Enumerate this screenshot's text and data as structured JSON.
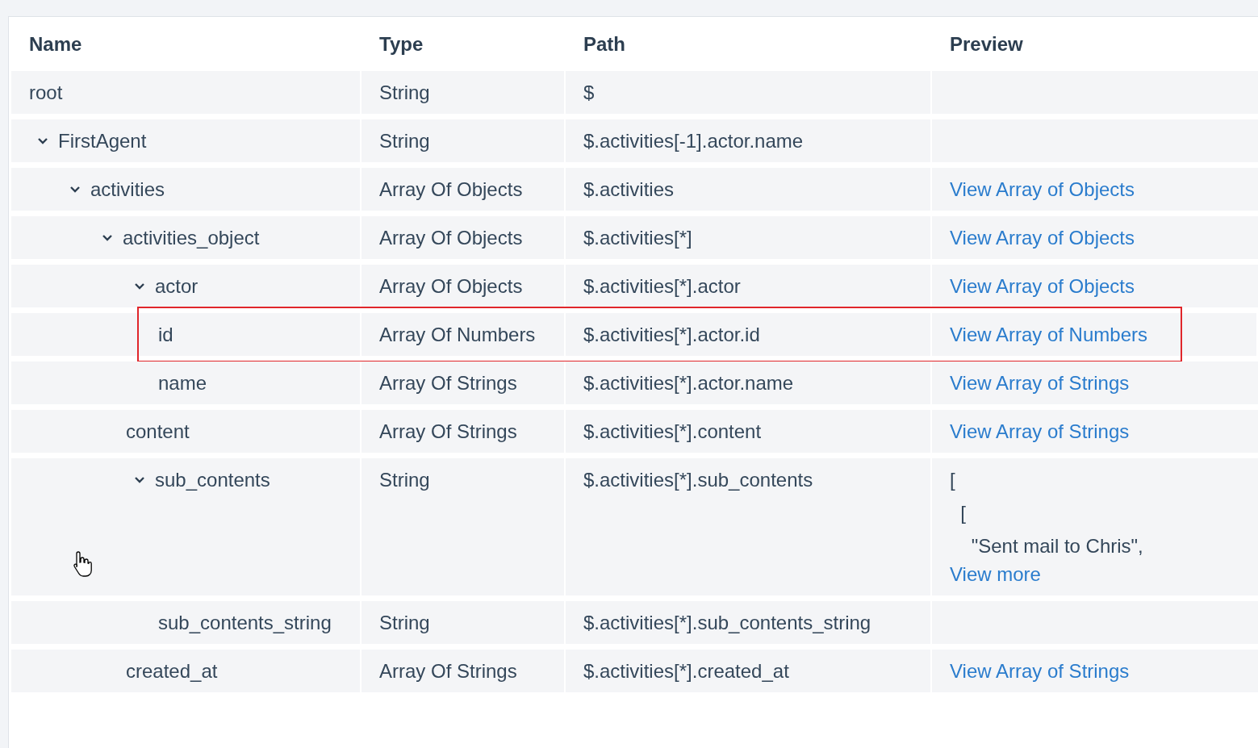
{
  "table": {
    "columns": [
      "Name",
      "Type",
      "Path",
      "Preview"
    ],
    "rows": [
      {
        "name": "root",
        "type": "String",
        "path": "$"
      },
      {
        "name": "FirstAgent",
        "type": "String",
        "path": "$.activities[-1].actor.name",
        "expanded": true,
        "children": [
          {
            "name": "activities",
            "type": "Array Of Objects",
            "path": "$.activities",
            "preview": {
              "link": "View Array of Objects"
            },
            "expanded": true,
            "children": [
              {
                "name": "activities_object",
                "type": "Array Of Objects",
                "path": "$.activities[*]",
                "preview": {
                  "link": "View Array of Objects"
                },
                "expanded": true,
                "children": [
                  {
                    "name": "actor",
                    "type": "Array Of Objects",
                    "path": "$.activities[*].actor",
                    "preview": {
                      "link": "View Array of Objects"
                    },
                    "expanded": true,
                    "children": [
                      {
                        "name": "id",
                        "type": "Array Of Numbers",
                        "path": "$.activities[*].actor.id",
                        "preview": {
                          "link": "View Array of Numbers"
                        },
                        "highlighted": true
                      },
                      {
                        "name": "name",
                        "type": "Array Of Strings",
                        "path": "$.activities[*].actor.name",
                        "preview": {
                          "link": "View Array of Strings"
                        }
                      }
                    ]
                  },
                  {
                    "name": "content",
                    "type": "Array Of Strings",
                    "path": "$.activities[*].content",
                    "preview": {
                      "link": "View Array of Strings"
                    }
                  },
                  {
                    "name": "sub_contents",
                    "type": "String",
                    "path": "$.activities[*].sub_contents",
                    "preview": {
                      "lines": [
                        "[",
                        "  [",
                        "    \"Sent mail to Chris\","
                      ],
                      "link": "View more"
                    },
                    "expanded": true,
                    "children": [
                      {
                        "name": "sub_contents_string",
                        "type": "String",
                        "path": "$.activities[*].sub_contents_string"
                      }
                    ]
                  },
                  {
                    "name": "created_at",
                    "type": "Array Of Strings",
                    "path": "$.activities[*].created_at",
                    "preview": {
                      "link": "View Array of Strings"
                    }
                  }
                ]
              }
            ]
          }
        ]
      }
    ]
  }
}
